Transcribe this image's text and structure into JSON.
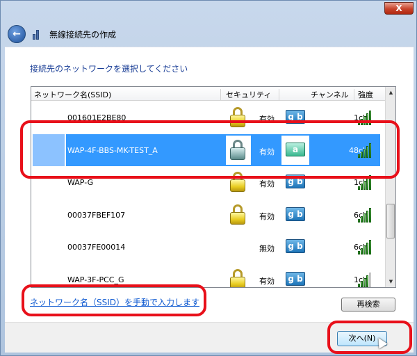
{
  "window": {
    "title": "無線接続先の作成",
    "close_label": "X"
  },
  "prompt": "接続先のネットワークを選択してください",
  "columns": {
    "ssid": "ネットワーク名(SSID)",
    "security": "セキュリティ",
    "channel": "チャンネル",
    "strength": "強度"
  },
  "networks": [
    {
      "ssid": "001601E2BE80",
      "security": "有効",
      "band": "g b",
      "channel": "1ch",
      "secured": true,
      "selected": false,
      "signal": 5
    },
    {
      "ssid": "WAP-4F-BBS-MK-TEST_A",
      "security": "有効",
      "band": "a",
      "channel": "48ch",
      "secured": true,
      "selected": true,
      "signal": 5
    },
    {
      "ssid": "WAP-G",
      "security": "有効",
      "band": "g b",
      "channel": "1ch",
      "secured": true,
      "selected": false,
      "signal": 5
    },
    {
      "ssid": "00037FBEF107",
      "security": "有効",
      "band": "g b",
      "channel": "6ch",
      "secured": true,
      "selected": false,
      "signal": 5
    },
    {
      "ssid": "00037FE00014",
      "security": "無効",
      "band": "g b",
      "channel": "6ch",
      "secured": false,
      "selected": false,
      "signal": 5
    },
    {
      "ssid": "WAP-3F-PCC_G",
      "security": "有効",
      "band": "g b",
      "channel": "1ch",
      "secured": true,
      "selected": false,
      "signal": 4
    }
  ],
  "manual_link": "ネットワーク名（SSID）を手動で入力します",
  "rescan_label": "再検索",
  "next_label": "次へ(N)",
  "colors": {
    "selection": "#3399ff",
    "callout": "#e8101a",
    "link": "#0b57d0"
  }
}
